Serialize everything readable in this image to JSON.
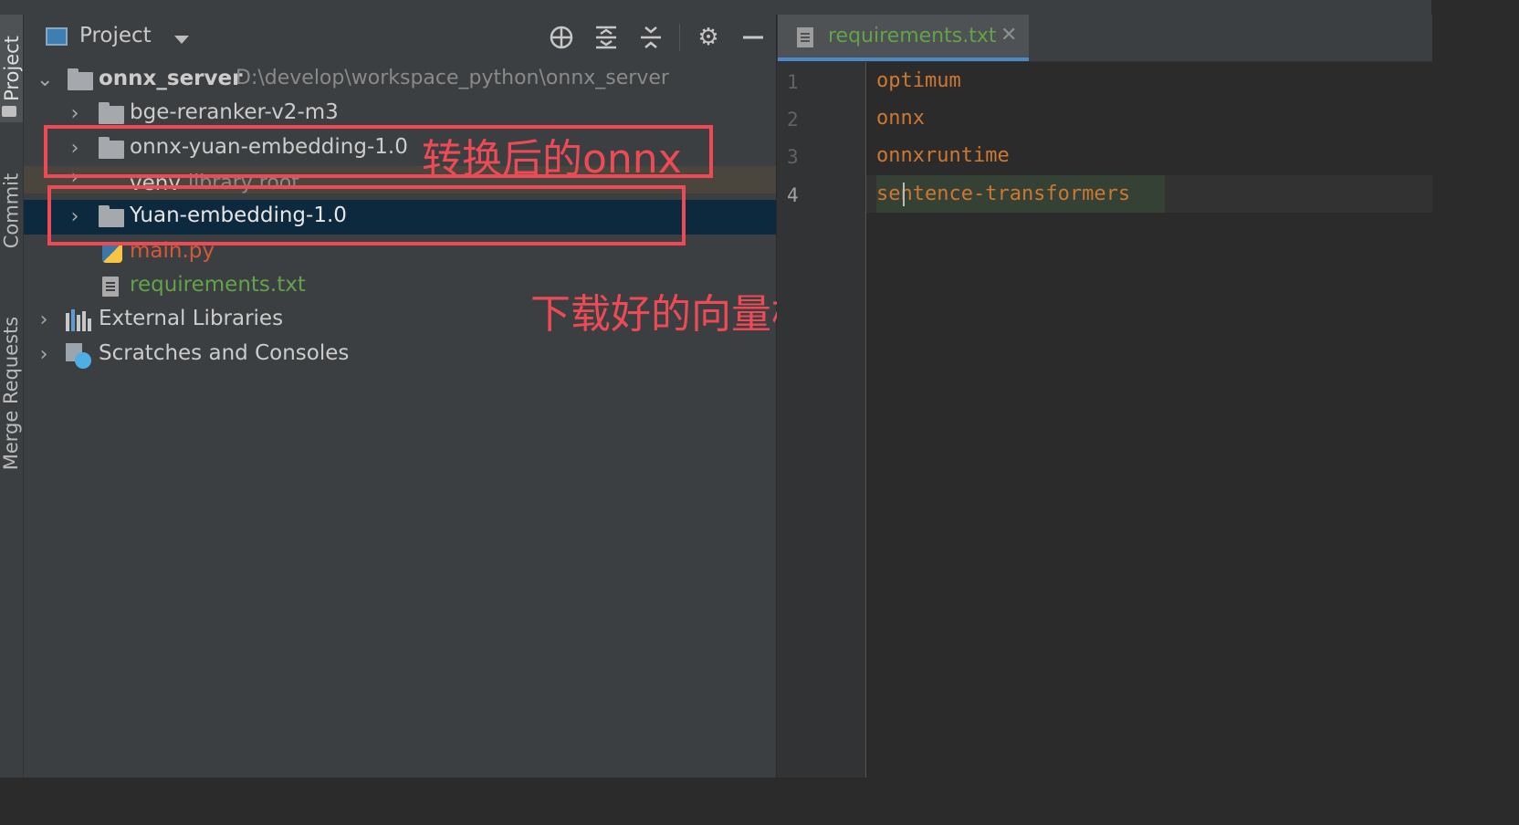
{
  "sidebar_tabs": {
    "project": "Project",
    "commit": "Commit",
    "merge_requests": "Merge Requests"
  },
  "project_panel": {
    "title": "Project",
    "tree": {
      "root": {
        "name": "onnx_server",
        "path": "D:\\develop\\workspace_python\\onnx_server"
      },
      "items": [
        {
          "name": "bge-reranker-v2-m3",
          "type": "folder"
        },
        {
          "name": "onnx-yuan-embedding-1.0",
          "type": "folder"
        },
        {
          "name": "venv",
          "note": "library root",
          "type": "folder"
        },
        {
          "name": "Yuan-embedding-1.0",
          "type": "folder",
          "selected": true
        },
        {
          "name": "main.py",
          "type": "python-file"
        },
        {
          "name": "requirements.txt",
          "type": "text-file"
        }
      ],
      "external_libraries": "External Libraries",
      "scratches": "Scratches and Consoles"
    }
  },
  "annotations": {
    "converted_onnx": "转换后的onnx",
    "downloaded_model": "下载好的向量模型",
    "color": "#ee4a55"
  },
  "editor": {
    "tab_label": "requirements.txt",
    "tab_close": "✕",
    "lines": [
      {
        "number": "1",
        "text": "optimum"
      },
      {
        "number": "2",
        "text": "onnx"
      },
      {
        "number": "3",
        "text": "onnxruntime"
      },
      {
        "number": "4",
        "text": "sentence-transformers"
      }
    ]
  },
  "colors": {
    "accent": "#4a88c7",
    "keyword": "#cc7832",
    "vcs_added": "#62a34a",
    "selection": "#0d293e"
  }
}
